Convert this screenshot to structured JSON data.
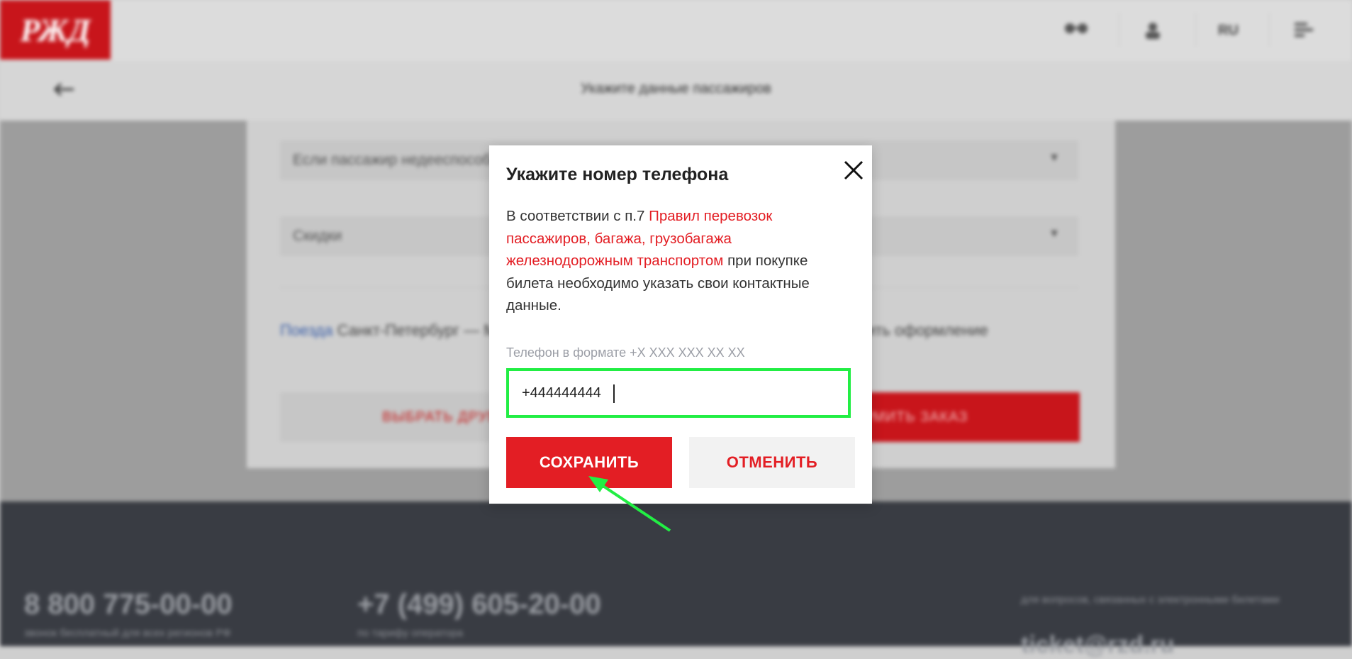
{
  "header": {
    "logo_text": "РЖД",
    "icons": [
      "glasses-icon",
      "user-icon",
      "language-icon",
      "menu-icon"
    ],
    "language": "RU"
  },
  "subheader": {
    "title": "Укажите данные пассажиров"
  },
  "form": {
    "field1": "Если пассажир недееспособен",
    "field2": "Скидки",
    "route_link": "Поезда",
    "route_text": "Санкт-Петербург — Москва (Ленинградский вокзал), поезд 722Р. Завершить оформление",
    "btn_outline": "ВЫБРАТЬ ДРУГОЙ ПОЕЗД",
    "btn_red": "ОФОРМИТЬ ЗАКАЗ"
  },
  "footer": {
    "phone1": "8 800 775-00-00",
    "phone1_note": "звонок бесплатный для всех регионов РФ",
    "phone2": "+7 (499) 605-20-00",
    "phone2_note": "по тарифу оператора",
    "mail_note": "для вопросов, связанных с электронными билетами",
    "mail": "ticket@rzd.ru"
  },
  "modal": {
    "title": "Укажите номер телефона",
    "text_before": "В соответствии с п.7 ",
    "text_link": "Правил перевозок пассажиров, багажа, грузобагажа железнодорожным транспортом",
    "text_after": " при покупке билета необходимо указать свои контактные данные.",
    "phone_label": "Телефон в формате +X XXX XXX XX XX",
    "phone_value": "+444444444",
    "save_label": "СОХРАНИТЬ",
    "cancel_label": "ОТМЕНИТЬ"
  },
  "colors": {
    "accent": "#e31e24",
    "highlight": "#22ee44",
    "footer_bg": "#393c43"
  }
}
